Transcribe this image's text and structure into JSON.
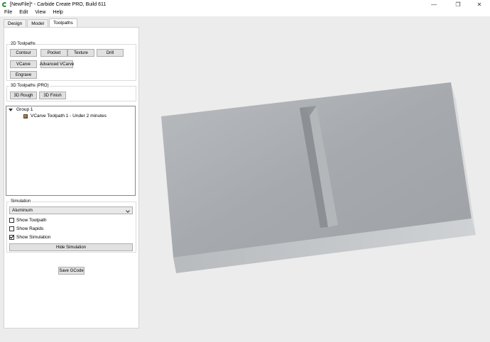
{
  "window": {
    "title": "[NewFile]* - Carbide Create PRO, Build 611",
    "minimize": "—",
    "maximize": "❐",
    "close": "✕"
  },
  "menu": [
    "File",
    "Edit",
    "View",
    "Help"
  ],
  "tabs": [
    {
      "label": "Design",
      "active": false
    },
    {
      "label": "Model",
      "active": false
    },
    {
      "label": "Toolpaths",
      "active": true
    }
  ],
  "toolpaths_2d": {
    "title": "2D Toolpaths",
    "buttons": [
      "Contour",
      "Pocket",
      "Texture",
      "Drill",
      "VCarve",
      "Advanced VCarve",
      "Engrave"
    ]
  },
  "toolpaths_3d": {
    "title": "3D Toolpaths (PRO)",
    "buttons": [
      "3D Rough",
      "3D Finish"
    ]
  },
  "tree": {
    "group_label": "Group 1",
    "items": [
      {
        "label": "VCarve Toolpath 1 - Under 2 minutes",
        "icon": "toolpath-icon"
      }
    ]
  },
  "simulation": {
    "title": "Simulation",
    "material": "Aluminum",
    "show_toolpath": {
      "label": "Show Toolpath",
      "checked": false
    },
    "show_rapids": {
      "label": "Show Rapids",
      "checked": false
    },
    "show_simulation": {
      "label": "Show Simulation",
      "checked": true
    },
    "hide_button": "Hide Simulation"
  },
  "save_gcode": "Save GCode",
  "colors": {
    "app_icon": "#2e8b3a",
    "stock_top": "#a9adb1",
    "stock_front": "#c6c9cc",
    "stock_side": "#dadcde"
  }
}
